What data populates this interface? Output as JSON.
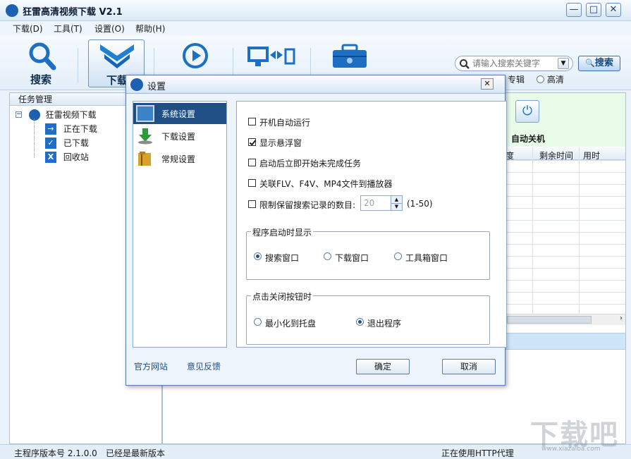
{
  "app": {
    "title": "狂雷高清视频下载  V2.1"
  },
  "menu": [
    "下载(D)",
    "工具(T)",
    "设置(O)",
    "帮助(H)"
  ],
  "toolbar": {
    "tools": [
      {
        "label": "搜索",
        "icon": "search-icon"
      },
      {
        "label": "下载",
        "icon": "download-icon",
        "selected": true
      },
      {
        "label": "播放",
        "icon": "play-icon"
      },
      {
        "label": "转换",
        "icon": "convert-icon"
      },
      {
        "label": "工具",
        "icon": "toolbox-icon"
      }
    ],
    "search_placeholder": "请输入搜索关键字",
    "search_button": "搜索",
    "quality_options": [
      "专辑",
      "高清"
    ]
  },
  "left_panel": {
    "header": "任务管理",
    "root": "狂雷视频下载",
    "items": [
      "正在下载",
      "已下载",
      "回收站"
    ]
  },
  "right_panel": {
    "auto_shutdown": "自动关机",
    "columns": [
      "度",
      "剩余时间",
      "用时"
    ]
  },
  "status_bar": {
    "version": "主程序版本号  2.1.0.0",
    "update_status": "已经是最新版本",
    "proxy": "正在使用HTTP代理"
  },
  "dialog": {
    "title": "设置",
    "nav": [
      "系统设置",
      "下载设置",
      "常规设置"
    ],
    "options": {
      "autostart": "开机自动运行",
      "float_window": "显示悬浮窗",
      "resume_tasks": "启动后立即开始未完成任务",
      "associate": "关联FLV、F4V、MP4文件到播放器",
      "limit_history": "限制保留搜索记录的数目:",
      "limit_value": "20",
      "limit_range": "(1-50)"
    },
    "startup_group": {
      "title": "程序启动时显示",
      "options": [
        "搜索窗口",
        "下载窗口",
        "工具箱窗口"
      ]
    },
    "close_group": {
      "title": "点击关闭按钮时",
      "options": [
        "最小化到托盘",
        "退出程序"
      ]
    },
    "links": [
      "官方网站",
      "意见反馈"
    ],
    "ok": "确定",
    "cancel": "取消"
  },
  "watermark": {
    "text": "下载吧",
    "url": "www.xiazaiba.com"
  },
  "colors": {
    "accent": "#1f4f85",
    "brand_blue": "#1d5fb0"
  }
}
